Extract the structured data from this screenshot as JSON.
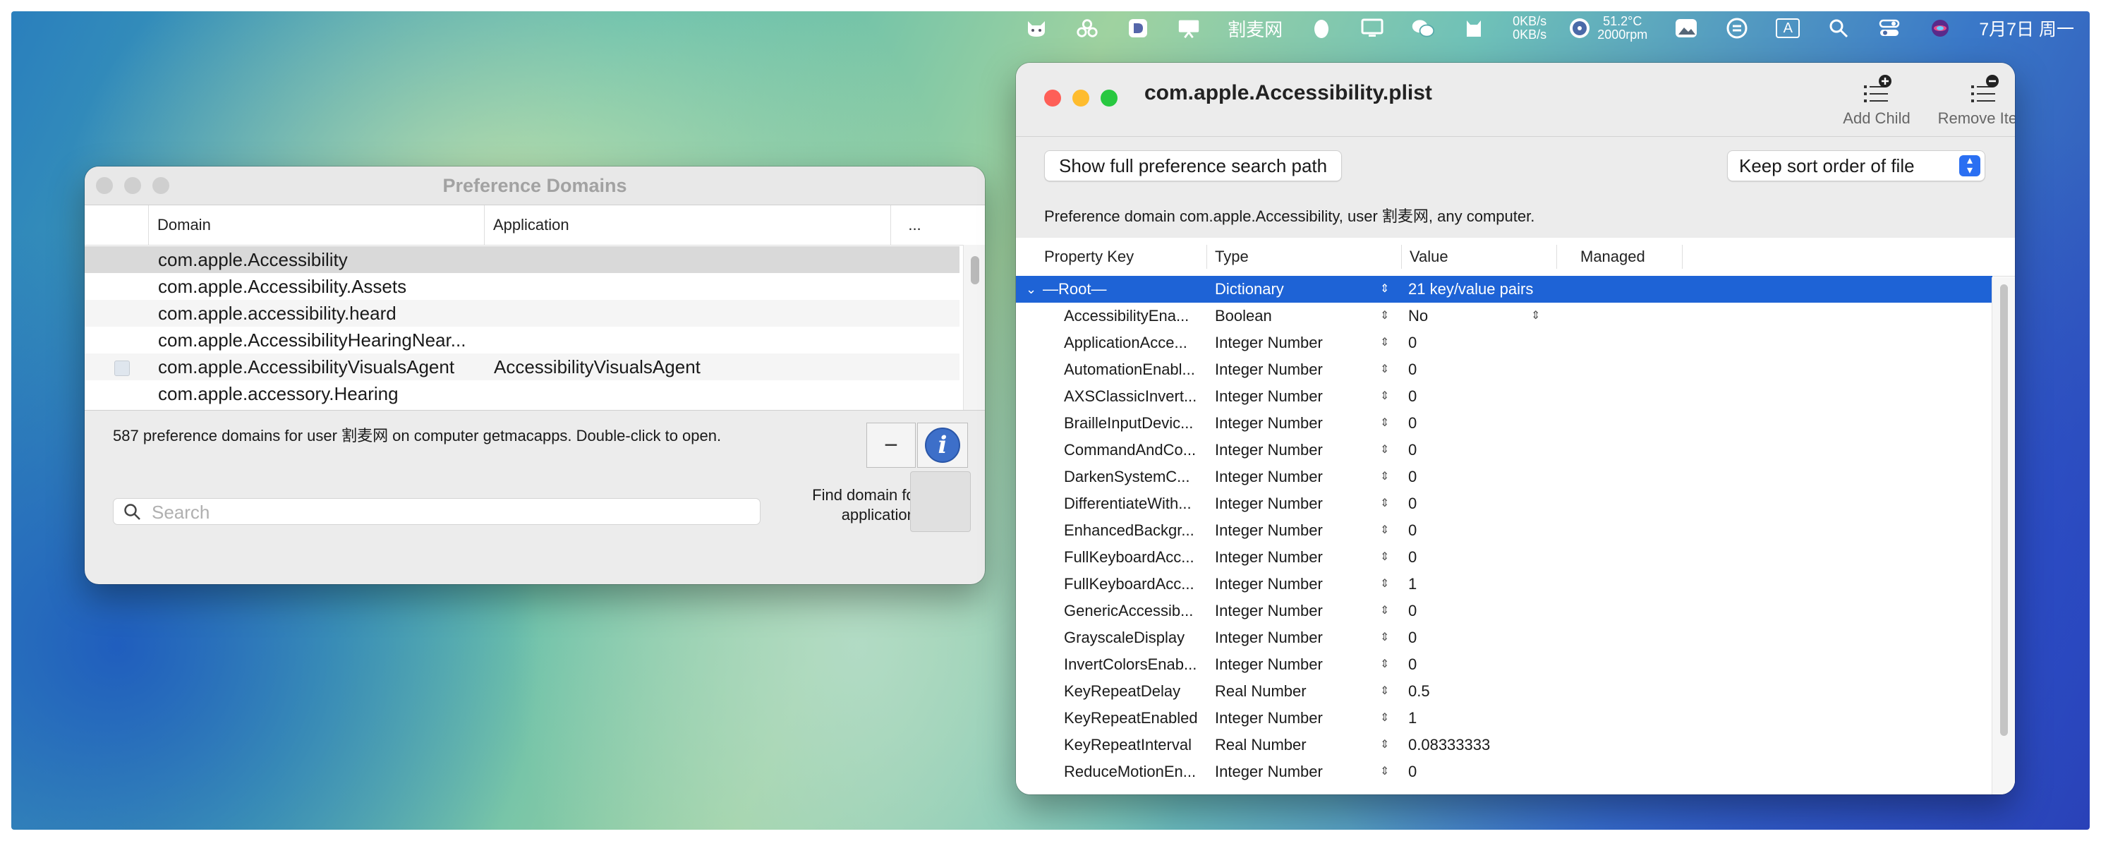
{
  "menubar": {
    "app_name": "割麦网",
    "net_up": "0KB/s",
    "net_down": "0KB/s",
    "temp": "51.2°C",
    "fan": "2000rpm",
    "input_mode": "A",
    "clock": "7月7日 周一"
  },
  "pref_domains": {
    "title": "Preference Domains",
    "columns": [
      "Domain",
      "Application",
      "..."
    ],
    "rows": [
      {
        "domain": "com.apple.Accessibility",
        "app": "",
        "selected": true,
        "checkbox": false
      },
      {
        "domain": "com.apple.Accessibility.Assets",
        "app": "",
        "selected": false,
        "checkbox": false
      },
      {
        "domain": "com.apple.accessibility.heard",
        "app": "",
        "selected": false,
        "checkbox": false
      },
      {
        "domain": "com.apple.AccessibilityHearingNear...",
        "app": "",
        "selected": false,
        "checkbox": false
      },
      {
        "domain": "com.apple.AccessibilityVisualsAgent",
        "app": "AccessibilityVisualsAgent",
        "selected": false,
        "checkbox": true
      },
      {
        "domain": "com.apple.accessory.Hearing",
        "app": "",
        "selected": false,
        "checkbox": false
      }
    ],
    "status": "587 preference domains for user 割麦网 on computer getmacapps. Double-click to open.",
    "minus_label": "−",
    "info_label": "i",
    "search_placeholder": "Search",
    "find_label_1": "Find domain for",
    "find_label_2": "application:"
  },
  "plist": {
    "title": "com.apple.Accessibility.plist",
    "add_child": "Add Child",
    "remove_item": "Remove Item",
    "show_path": "Show full preference search path",
    "sort_order": "Keep sort order of file",
    "description": "Preference domain com.apple.Accessibility, user 割麦网, any computer.",
    "columns": {
      "key": "Property Key",
      "type": "Type",
      "value": "Value",
      "managed": "Managed"
    },
    "root": {
      "key": "—Root—",
      "type": "Dictionary",
      "value": "21 key/value pairs"
    },
    "rows": [
      {
        "key": "AccessibilityEna...",
        "type": "Boolean",
        "value": "No",
        "popup": true
      },
      {
        "key": "ApplicationAcce...",
        "type": "Integer Number",
        "value": "0"
      },
      {
        "key": "AutomationEnabl...",
        "type": "Integer Number",
        "value": "0"
      },
      {
        "key": "AXSClassicInvert...",
        "type": "Integer Number",
        "value": "0"
      },
      {
        "key": "BrailleInputDevic...",
        "type": "Integer Number",
        "value": "0"
      },
      {
        "key": "CommandAndCo...",
        "type": "Integer Number",
        "value": "0"
      },
      {
        "key": "DarkenSystemC...",
        "type": "Integer Number",
        "value": "0"
      },
      {
        "key": "DifferentiateWith...",
        "type": "Integer Number",
        "value": "0"
      },
      {
        "key": "EnhancedBackgr...",
        "type": "Integer Number",
        "value": "0"
      },
      {
        "key": "FullKeyboardAcc...",
        "type": "Integer Number",
        "value": "0"
      },
      {
        "key": "FullKeyboardAcc...",
        "type": "Integer Number",
        "value": "1"
      },
      {
        "key": "GenericAccessib...",
        "type": "Integer Number",
        "value": "0"
      },
      {
        "key": "GrayscaleDisplay",
        "type": "Integer Number",
        "value": "0"
      },
      {
        "key": "InvertColorsEnab...",
        "type": "Integer Number",
        "value": "0"
      },
      {
        "key": "KeyRepeatDelay",
        "type": "Real Number",
        "value": "0.5"
      },
      {
        "key": "KeyRepeatEnabled",
        "type": "Integer Number",
        "value": "1"
      },
      {
        "key": "KeyRepeatInterval",
        "type": "Real Number",
        "value": "0.08333333"
      },
      {
        "key": "ReduceMotionEn...",
        "type": "Integer Number",
        "value": "0"
      }
    ]
  },
  "colors": {
    "selection": "#1e63d6",
    "close": "#fe5f57",
    "minimize": "#febc2e",
    "zoom": "#28c840",
    "inactive_light": "#cfcfcf"
  }
}
